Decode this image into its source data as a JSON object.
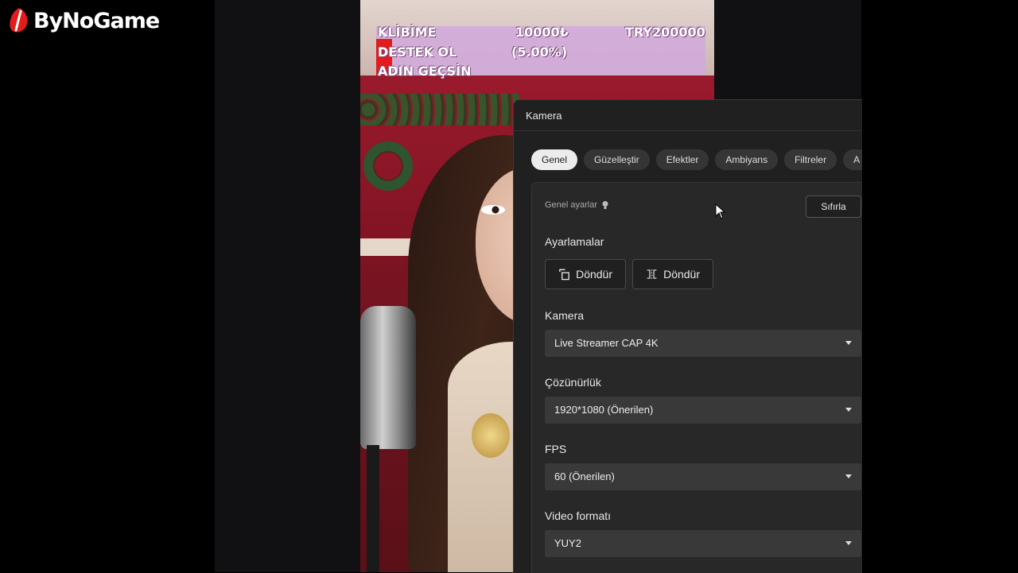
{
  "brand": {
    "name": "ByNoGame"
  },
  "overlay": {
    "row1": {
      "left": "KLİBİME",
      "mid": "10000₺",
      "right": "TRY200000"
    },
    "row2": {
      "left": "DESTEK OL",
      "mid": "(5.00%)"
    },
    "row3": {
      "left": "ADIN GEÇSİN"
    }
  },
  "panel": {
    "title": "Kamera",
    "tabs": [
      "Genel",
      "Güzelleştir",
      "Efektler",
      "Ambiyans",
      "Filtreler",
      "A"
    ],
    "active_tab": "Genel",
    "section_label": "Genel ayarlar",
    "reset_label": "Sıfırla",
    "adjust_label": "Ayarlamalar",
    "rotate_label": "Döndür",
    "flip_label": "Döndür",
    "camera": {
      "label": "Kamera",
      "value": "Live Streamer CAP 4K"
    },
    "resolution": {
      "label": "Çözünürlük",
      "value": "1920*1080 (Önerilen)"
    },
    "fps": {
      "label": "FPS",
      "value": "60 (Önerilen)"
    },
    "video_format": {
      "label": "Video formatı",
      "value": "YUY2"
    }
  },
  "colors": {
    "accent_red": "#e21b1b",
    "overlay_pink": "#d2aadc",
    "panel_bg": "#202020"
  }
}
